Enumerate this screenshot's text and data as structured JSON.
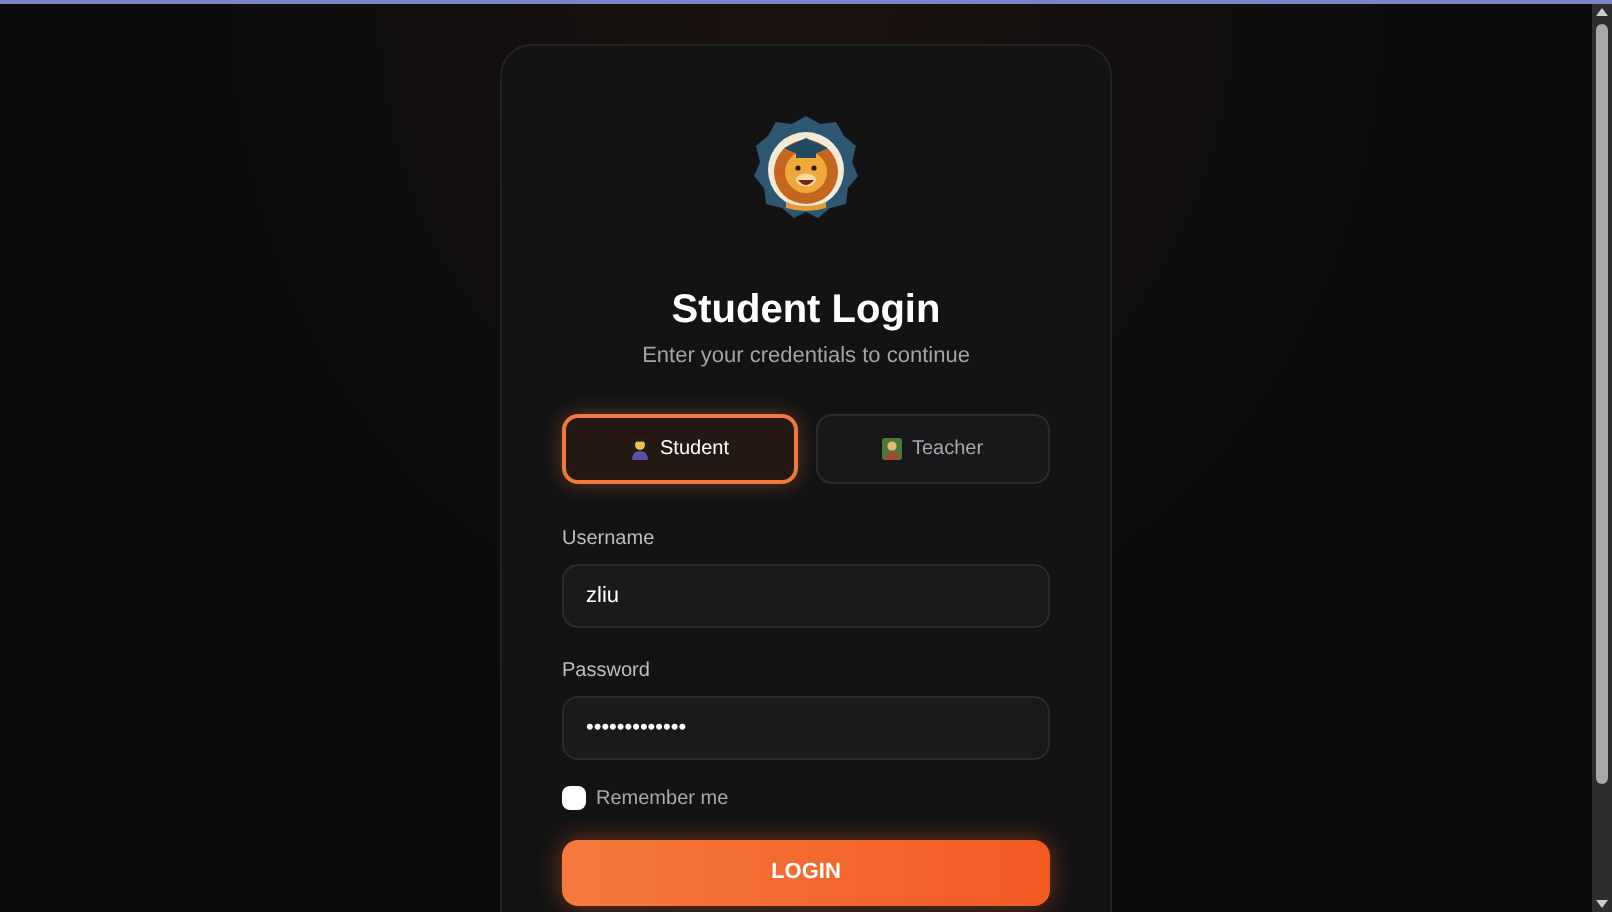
{
  "title": "Student Login",
  "subtitle": "Enter your credentials to continue",
  "roles": [
    {
      "label": "Student",
      "kind": "student",
      "selected": true
    },
    {
      "label": "Teacher",
      "kind": "teacher",
      "selected": false
    }
  ],
  "fields": [
    {
      "label": "Username",
      "value": "zliu"
    },
    {
      "label": "Password",
      "value": "•••••••••••••"
    }
  ],
  "remember": {
    "label": "Remember me",
    "checked": false
  },
  "login_button": "LOGIN"
}
